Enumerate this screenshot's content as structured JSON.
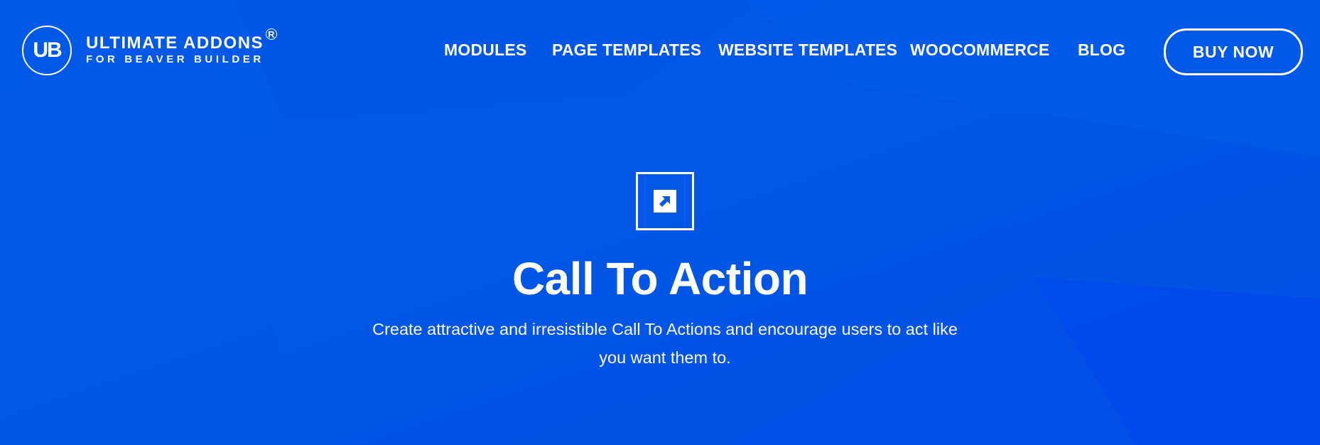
{
  "colors": {
    "background": "#0059E6",
    "accent_dark": "#0246EA",
    "text": "#FFFFFF"
  },
  "logo": {
    "monogram": "UB",
    "title": "ULTIMATE ADDONS",
    "subtitle": "FOR BEAVER BUILDER",
    "registered": "R"
  },
  "nav": {
    "items": [
      {
        "label": "MODULES"
      },
      {
        "label": "PAGE TEMPLATES"
      },
      {
        "label": "WEBSITE TEMPLATES"
      },
      {
        "label": "WOOCOMMERCE"
      },
      {
        "label": "BLOG"
      }
    ],
    "cta_label": "BUY NOW"
  },
  "hero": {
    "icon": "external-link-arrow-icon",
    "title": "Call To Action",
    "description": "Create attractive and irresistible Call To Actions and encourage users to act like you want them to."
  }
}
